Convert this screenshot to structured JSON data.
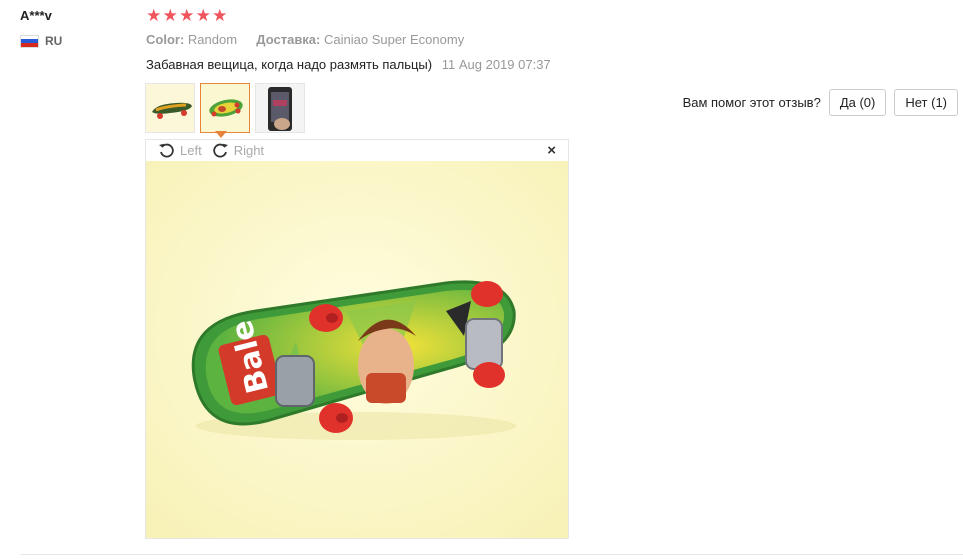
{
  "review": {
    "user_name": "A***v",
    "country": "RU",
    "rating": 5,
    "color_label": "Color:",
    "color_value": "Random",
    "shipping_label": "Доставка:",
    "shipping_value": "Cainiao Super Economy",
    "text": "Забавная вещица, когда надо размять пальцы)",
    "date": "11 Aug 2019 07:37"
  },
  "helpful": {
    "question": "Вам помог этот отзыв?",
    "yes_label": "Да (0)",
    "no_label": "Нет (1)"
  },
  "viewer": {
    "rotate_left_label": "Left",
    "rotate_right_label": "Right",
    "close_label": "×"
  },
  "colors": {
    "star": "#f0545c",
    "active_thumb_border": "#e8833a",
    "viewer_background": "#fdfbd0"
  }
}
